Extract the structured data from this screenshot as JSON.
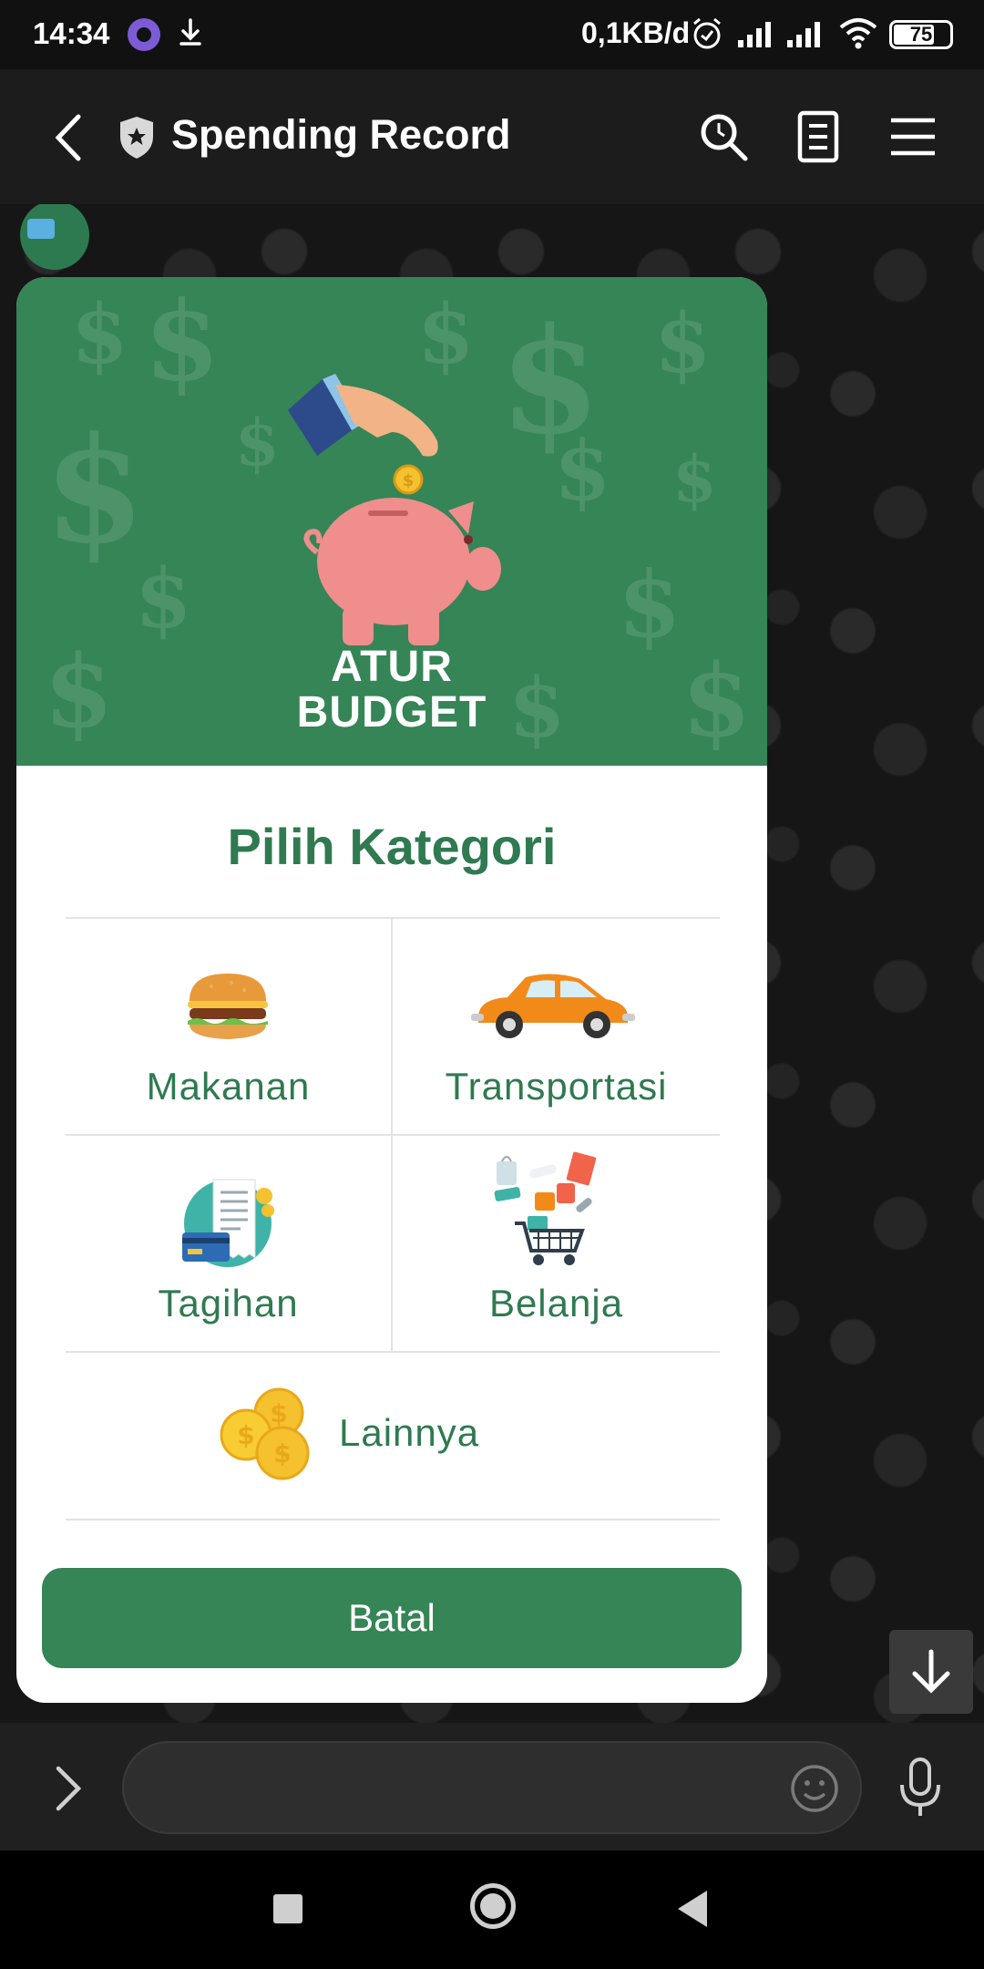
{
  "status_bar": {
    "time": "14:34",
    "network_speed": "0,1KB/d",
    "battery_level": 75,
    "battery_text": "75"
  },
  "app_bar": {
    "title": "Spending Record",
    "icons": [
      "back-icon",
      "shield-star-icon",
      "search-icon",
      "notes-icon",
      "menu-icon"
    ]
  },
  "card": {
    "banner_lines": [
      "ATUR",
      "BUDGET"
    ],
    "heading": "Pilih Kategori",
    "categories": [
      {
        "label": "Makanan",
        "icon": "burger-icon"
      },
      {
        "label": "Transportasi",
        "icon": "car-icon"
      },
      {
        "label": "Tagihan",
        "icon": "bill-icon"
      },
      {
        "label": "Belanja",
        "icon": "shopping-cart-icon"
      },
      {
        "label": "Lainnya",
        "icon": "coins-icon"
      }
    ],
    "cancel_label": "Batal",
    "brand_color": "#358556",
    "text_color": "#2f7a50"
  },
  "input_bar": {
    "value": "",
    "placeholder": ""
  }
}
